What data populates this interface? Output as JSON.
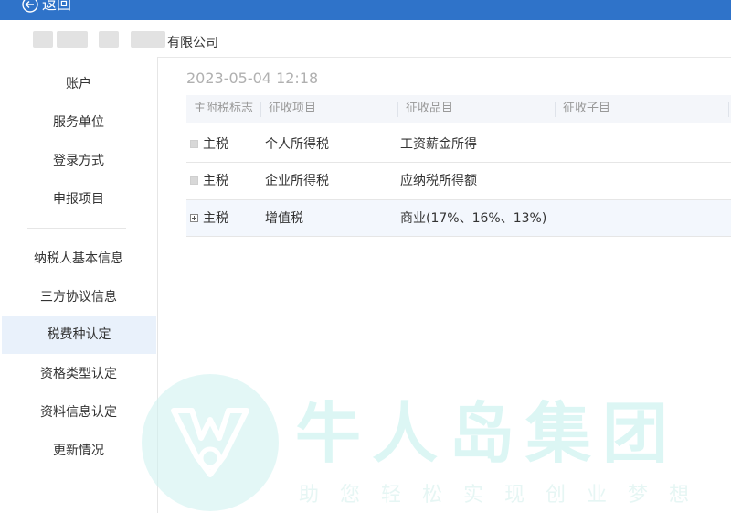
{
  "header": {
    "back_label": "返回"
  },
  "company": {
    "name_suffix": "有限公司"
  },
  "sidebar": {
    "items": [
      {
        "label": "账户"
      },
      {
        "label": "服务单位"
      },
      {
        "label": "登录方式"
      },
      {
        "label": "申报项目"
      },
      {
        "label": "纳税人基本信息"
      },
      {
        "label": "三方协议信息"
      },
      {
        "label": "税费种认定",
        "active": true
      },
      {
        "label": "资格类型认定"
      },
      {
        "label": "资料信息认定"
      },
      {
        "label": "更新情况"
      }
    ]
  },
  "main": {
    "date": "2023-05-04 12:18",
    "table": {
      "columns": [
        "主附税标志",
        "征收项目",
        "征收品目",
        "征收子目"
      ],
      "rows": [
        {
          "flag": "主税",
          "item": "个人所得税",
          "category": "工资薪金所得",
          "subitem": ""
        },
        {
          "flag": "主税",
          "item": "企业所得税",
          "category": "应纳税所得额",
          "subitem": ""
        },
        {
          "flag": "主税",
          "item": "增值税",
          "category": "商业(17%、16%、13%)",
          "subitem": ""
        }
      ]
    }
  },
  "watermark": {
    "title": "牛人岛集团",
    "slogan": "助您轻松实现创业梦想"
  },
  "colors": {
    "topbar": "#2f73c9",
    "active_nav": "#e9f1fb",
    "watermark": "#d4f4f2"
  }
}
